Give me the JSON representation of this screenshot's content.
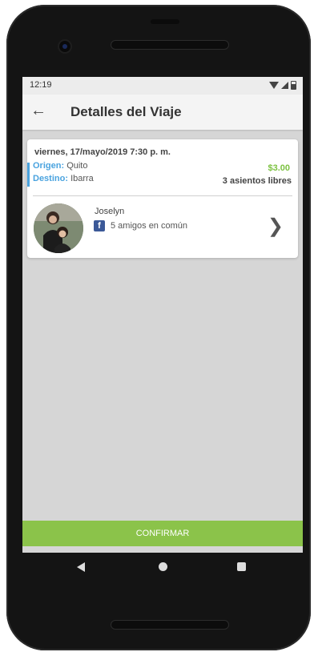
{
  "status_bar": {
    "time": "12:19"
  },
  "app_bar": {
    "title": "Detalles del Viaje"
  },
  "trip": {
    "date_time": "viernes, 17/mayo/2019   7:30 p. m.",
    "origin_label": "Origen:",
    "origin_value": "Quito",
    "destination_label": "Destino:",
    "destination_value": "Ibarra",
    "price": "$3.00",
    "seats": "3 asientos libres"
  },
  "driver": {
    "name": "Joselyn",
    "facebook_glyph": "f",
    "mutual_friends": "5 amigos en común"
  },
  "actions": {
    "confirm_label": "CONFIRMAR"
  },
  "colors": {
    "accent_blue": "#4aa3df",
    "price_green": "#7cc241",
    "confirm_green": "#8bc34a",
    "facebook_blue": "#3b5998"
  },
  "icons": [
    "back-arrow-icon",
    "wifi-icon",
    "signal-icon",
    "battery-icon",
    "facebook-icon",
    "chevron-right-icon",
    "nav-back-icon",
    "nav-home-icon",
    "nav-recents-icon"
  ]
}
